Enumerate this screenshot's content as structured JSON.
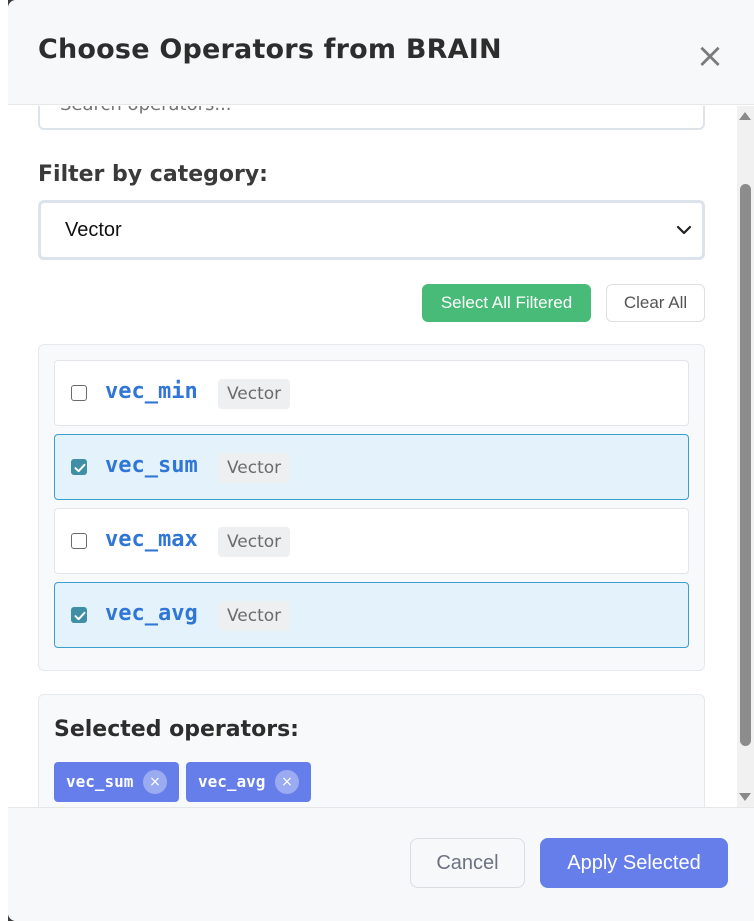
{
  "modal": {
    "title": "Choose Operators from BRAIN",
    "close_glyph": "×"
  },
  "search": {
    "placeholder": "Search operators..."
  },
  "filter": {
    "label": "Filter by category:",
    "selected": "Vector"
  },
  "actions": {
    "select_all_label": "Select All Filtered",
    "clear_all_label": "Clear All"
  },
  "operators": [
    {
      "name": "vec_min",
      "category": "Vector",
      "checked": false
    },
    {
      "name": "vec_sum",
      "category": "Vector",
      "checked": true
    },
    {
      "name": "vec_max",
      "category": "Vector",
      "checked": false
    },
    {
      "name": "vec_avg",
      "category": "Vector",
      "checked": true
    }
  ],
  "selected_panel": {
    "title": "Selected operators:",
    "chips": [
      {
        "label": "vec_sum",
        "remove_glyph": "×"
      },
      {
        "label": "vec_avg",
        "remove_glyph": "×"
      }
    ]
  },
  "footer": {
    "cancel_label": "Cancel",
    "apply_label": "Apply Selected"
  },
  "colors": {
    "accent": "#667eea",
    "success": "#48bb78",
    "operator_name": "#3076d6",
    "selected_row_bg": "#e3f2fb",
    "selected_row_border": "#3b9ed3"
  }
}
